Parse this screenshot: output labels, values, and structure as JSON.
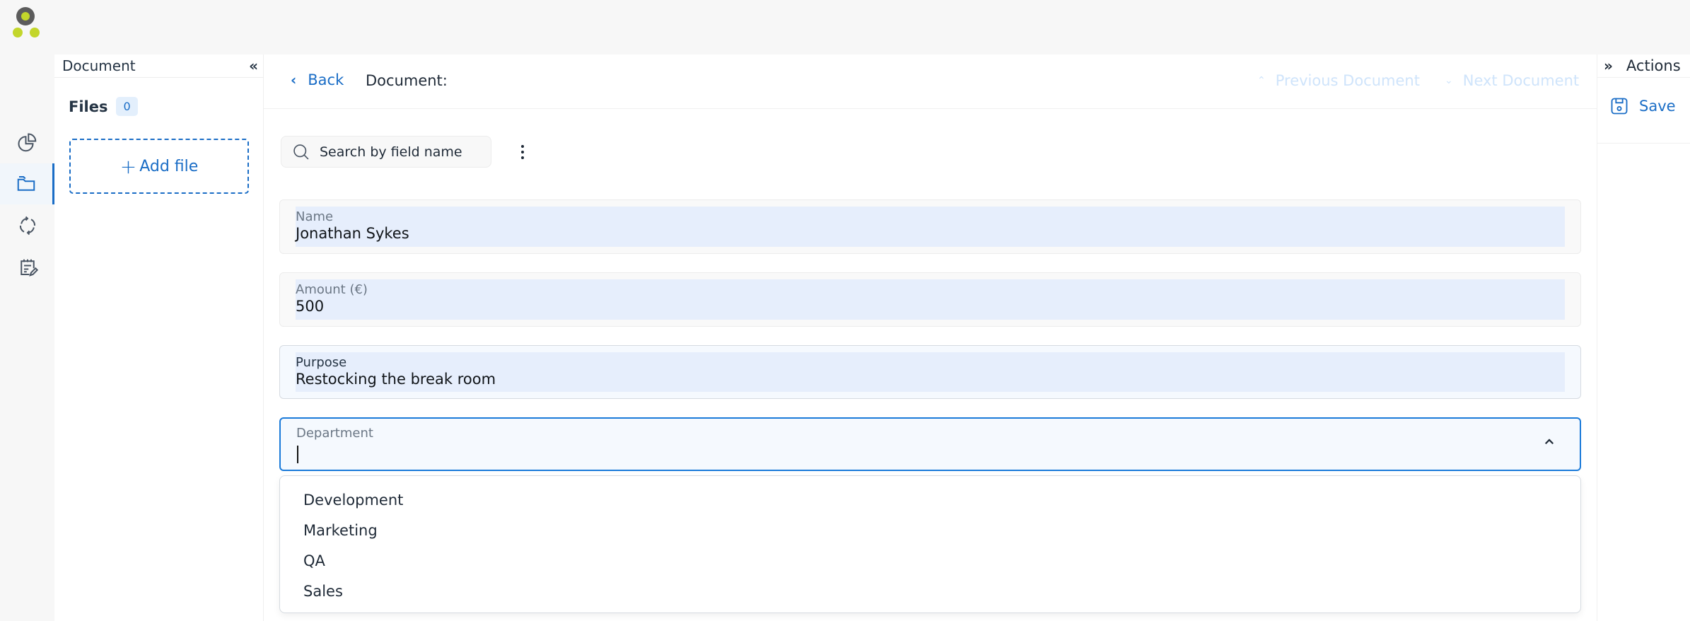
{
  "app": {
    "logo": "app-logo"
  },
  "nav": {
    "items": [
      {
        "name": "dashboard",
        "icon": "pie-chart-icon",
        "active": false
      },
      {
        "name": "documents",
        "icon": "folder-icon",
        "active": true
      },
      {
        "name": "workflows",
        "icon": "refresh-cycle-icon",
        "active": false
      },
      {
        "name": "tasks",
        "icon": "notepad-edit-icon",
        "active": false
      }
    ]
  },
  "doc_panel": {
    "title": "Document",
    "collapse_icon": "«",
    "files_label": "Files",
    "files_count": "0",
    "add_file_plus": "+",
    "add_file_label": "Add file"
  },
  "header": {
    "back_label": "Back",
    "back_icon": "‹",
    "document_label": "Document:",
    "previous_label": "Previous Document",
    "previous_icon": "⌃",
    "next_label": "Next Document",
    "next_icon": "⌄"
  },
  "search": {
    "placeholder": "Search by field name",
    "value": ""
  },
  "fields": [
    {
      "label": "Name",
      "value": "Jonathan Sykes"
    },
    {
      "label": "Amount (€)",
      "value": "500"
    },
    {
      "label": "Purpose",
      "value": "Restocking the break room"
    }
  ],
  "department": {
    "label": "Department",
    "value": "",
    "options": [
      "Development",
      "Marketing",
      "QA",
      "Sales"
    ]
  },
  "actions": {
    "expand_icon": "»",
    "title": "Actions",
    "save_label": "Save"
  },
  "colors": {
    "accent": "#1a6dc6",
    "logo_green": "#c3d62b",
    "logo_gray": "#5c5c5c",
    "field_fill": "#e6eefc",
    "disabled_link": "#cfe4fb"
  }
}
